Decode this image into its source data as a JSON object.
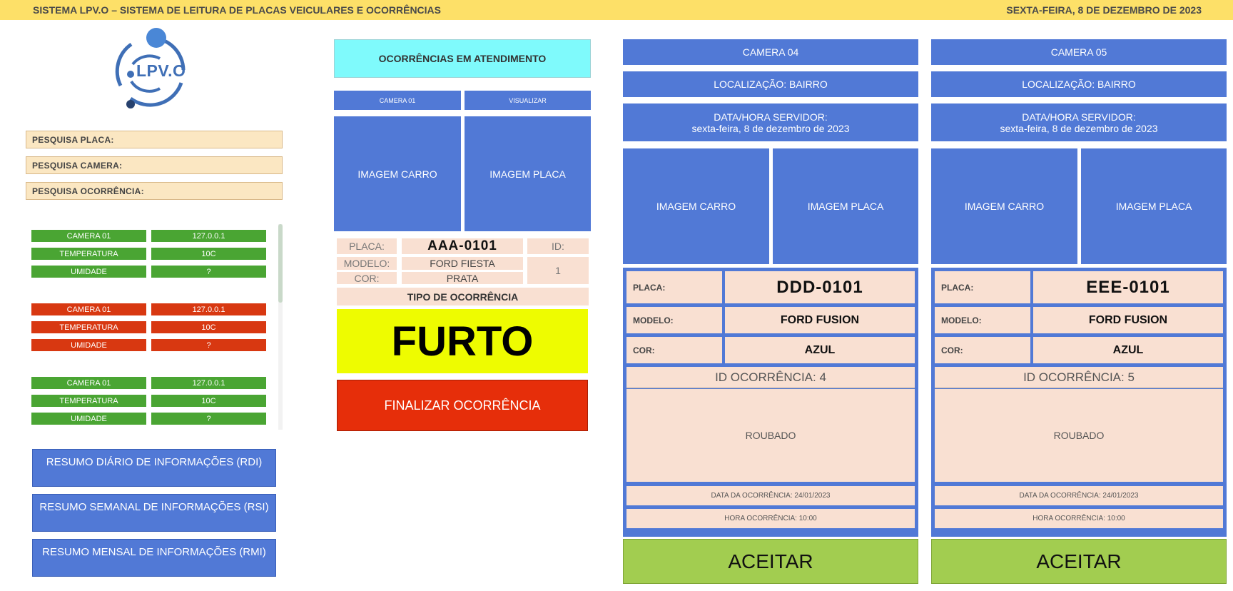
{
  "header": {
    "title": "SISTEMA LPV.O – SISTEMA DE LEITURA DE PLACAS VEICULARES E OCORRÊNCIAS",
    "date": "SEXTA-FEIRA, 8 DE DEZEMBRO DE 2023"
  },
  "logo": {
    "text": "LPV.O",
    "accent_color": "#3f6fb6"
  },
  "search": {
    "placa": "PESQUISA PLACA:",
    "camera": "PESQUISA CAMERA:",
    "ocorrencia": "PESQUISA OCORRÊNCIA:"
  },
  "sensors": [
    {
      "status": "green",
      "camera": "CAMERA 01",
      "ip": "127.0.0.1",
      "temp_label": "TEMPERATURA",
      "temp": "10C",
      "hum_label": "UMIDADE",
      "hum": "?"
    },
    {
      "status": "red",
      "camera": "CAMERA 01",
      "ip": "127.0.0.1",
      "temp_label": "TEMPERATURA",
      "temp": "10C",
      "hum_label": "UMIDADE",
      "hum": "?"
    },
    {
      "status": "green",
      "camera": "CAMERA 01",
      "ip": "127.0.0.1",
      "temp_label": "TEMPERATURA",
      "temp": "10C",
      "hum_label": "UMIDADE",
      "hum": "?"
    }
  ],
  "reports": {
    "rdi": "RESUMO DIÁRIO DE INFORMAÇÕES (RDI)",
    "rsi": "RESUMO SEMANAL DE INFORMAÇÕES (RSI)",
    "rmi": "RESUMO MENSAL DE INFORMAÇÕES (RMI)"
  },
  "atendimento": {
    "title": "OCORRÊNCIAS EM ATENDIMENTO",
    "camera": "CAMERA 01",
    "visualizar": "VISUALIZAR",
    "img_carro": "IMAGEM CARRO",
    "img_placa": "IMAGEM PLACA",
    "placa_label": "PLACA:",
    "placa": "AAA-0101",
    "id_label": "ID:",
    "id": "1",
    "modelo_label": "MODELO:",
    "modelo": "FORD FIESTA",
    "cor_label": "COR:",
    "cor": "PRATA",
    "tipo_label": "TIPO DE OCORRÊNCIA",
    "tipo": "FURTO",
    "finalizar": "FINALIZAR OCORRÊNCIA"
  },
  "cameras": [
    {
      "name": "CAMERA 04",
      "location": "LOCALIZAÇÃO: BAIRRO",
      "server_label": "DATA/HORA SERVIDOR:",
      "server_date": "sexta-feira, 8 de dezembro de 2023",
      "img_carro": "IMAGEM CARRO",
      "img_placa": "IMAGEM PLACA",
      "placa_label": "PLACA:",
      "placa": "DDD-0101",
      "modelo_label": "MODELO:",
      "modelo": "FORD FUSION",
      "cor_label": "COR:",
      "cor": "AZUL",
      "id_ocorrencia": "ID OCORRÊNCIA: 4",
      "descricao": "ROUBADO",
      "data": "DATA DA OCORRÊNCIA: 24/01/2023",
      "hora": "HORA OCORRÊNCIA: 10:00",
      "aceitar": "ACEITAR"
    },
    {
      "name": "CAMERA 05",
      "location": "LOCALIZAÇÃO: BAIRRO",
      "server_label": "DATA/HORA SERVIDOR:",
      "server_date": "sexta-feira, 8 de dezembro de 2023",
      "img_carro": "IMAGEM CARRO",
      "img_placa": "IMAGEM PLACA",
      "placa_label": "PLACA:",
      "placa": "EEE-0101",
      "modelo_label": "MODELO:",
      "modelo": "FORD FUSION",
      "cor_label": "COR:",
      "cor": "AZUL",
      "id_ocorrencia": "ID OCORRÊNCIA: 5",
      "descricao": "ROUBADO",
      "data": "DATA DA OCORRÊNCIA: 24/01/2023",
      "hora": "HORA OCORRÊNCIA: 10:00",
      "aceitar": "ACEITAR"
    }
  ],
  "colors": {
    "header_bg": "#fde068",
    "panel_blue": "#5179d6",
    "peach": "#f9e0d2",
    "cyan": "#7ffafc",
    "furto_yellow": "#eefc00",
    "finalizar_red": "#e62e0a",
    "aceitar_green": "#a2cd50",
    "status_green": "#4aa533",
    "status_red": "#d83811"
  }
}
